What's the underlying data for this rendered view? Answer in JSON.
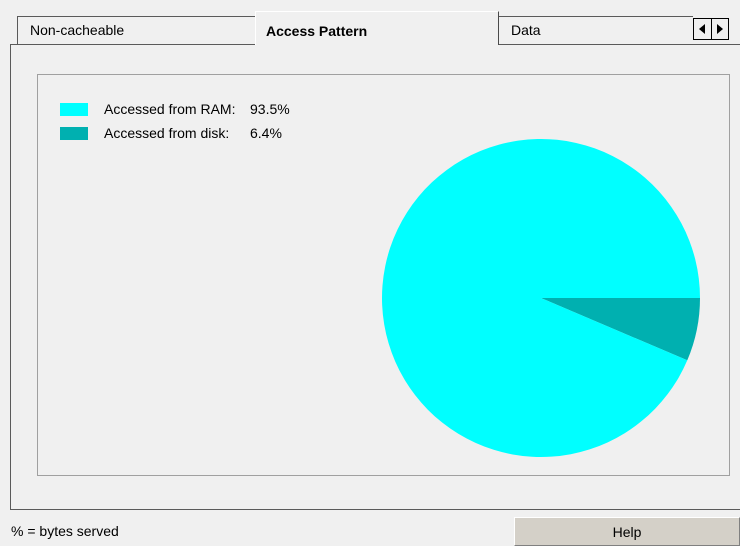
{
  "tabs": [
    {
      "label": "Non-cacheable",
      "active": false
    },
    {
      "label": "Access Pattern",
      "active": true
    },
    {
      "label": "Data",
      "active": false
    }
  ],
  "tab_scroll": {
    "left_icon": "arrow-left-icon",
    "right_icon": "arrow-right-icon"
  },
  "legend": [
    {
      "label": "Accessed from RAM:",
      "value": "93.5%",
      "color": "#00ffff"
    },
    {
      "label": "Accessed from disk:",
      "value": "6.4%",
      "color": "#00b0b0"
    }
  ],
  "chart_data": {
    "type": "pie",
    "title": "",
    "slices": [
      {
        "label": "Accessed from RAM",
        "value": 93.5,
        "color": "#00ffff"
      },
      {
        "label": "Accessed from disk",
        "value": 6.4,
        "color": "#00b0b0"
      }
    ],
    "start_angle_deg": 0,
    "direction": "clockwise",
    "legend_position": "top-left"
  },
  "status": {
    "note": "% = bytes served"
  },
  "buttons": {
    "help": "Help"
  }
}
